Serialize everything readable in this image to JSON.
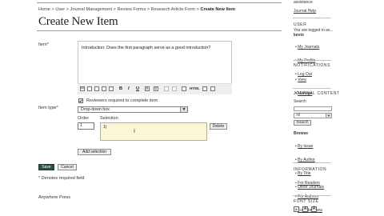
{
  "breadcrumb": {
    "items": [
      "Home",
      "User",
      "Journal Management",
      "Review Forms",
      "Research Article Form"
    ],
    "separator": ">",
    "current": "Create New Item"
  },
  "page_title": "Create New Item",
  "form": {
    "item_label": "Item*",
    "item_value": "Introduction: Does the first paragraph serve as a good introduction?",
    "toolbar_icons": [
      "cut-icon",
      "copy-icon",
      "paste-icon",
      "paste-text-icon",
      "paste-word-icon",
      "bold-icon",
      "italic-icon",
      "underline-icon",
      "bullet-list-icon",
      "numbered-list-icon",
      "link-icon",
      "unlink-icon",
      "image-icon",
      "html-icon",
      "fullscreen-icon",
      "image-upload-icon"
    ],
    "toolbar_text": {
      "bold": "B",
      "italic": "I",
      "underline": "U",
      "html": "HTML"
    },
    "reviewers_required_checked": true,
    "reviewers_required_label": "Reviewers required to complete item",
    "item_type_label": "Item type*",
    "item_type_value": "Drop-down box",
    "order_label": "Order",
    "selection_label": "Selection",
    "order_value": "1",
    "selection_value": "1|",
    "delete_label": "Delete",
    "add_selection_label": "Add selection",
    "save_label": "Save",
    "cancel_label": "Cancel",
    "required_note": "* Denotes required field"
  },
  "footer_text": "Anywhere Press",
  "sidebar": {
    "top_text": "assistance",
    "journal_help": "Journal Help",
    "user_heading": "USER",
    "logged_in_text": "You are logged in as...",
    "username": "kevin",
    "user_links": [
      "My Journals",
      "My Profile",
      "Log Out"
    ],
    "notifications_heading": "NOTIFICATIONS",
    "notification_links": [
      "View",
      "Manage"
    ],
    "journal_content_heading": "JOURNAL CONTENT",
    "search_label": "Search",
    "search_scope": "All",
    "search_button": "Search",
    "browse_label": "Browse",
    "browse_links": [
      "By Issue",
      "By Author",
      "By Title",
      "Other Journals"
    ],
    "information_heading": "INFORMATION",
    "information_links": [
      "For Readers",
      "For Authors",
      "For Librarians"
    ],
    "font_size_heading": "FONT SIZE",
    "font_size_buttons": [
      "A",
      "A",
      "A"
    ]
  }
}
